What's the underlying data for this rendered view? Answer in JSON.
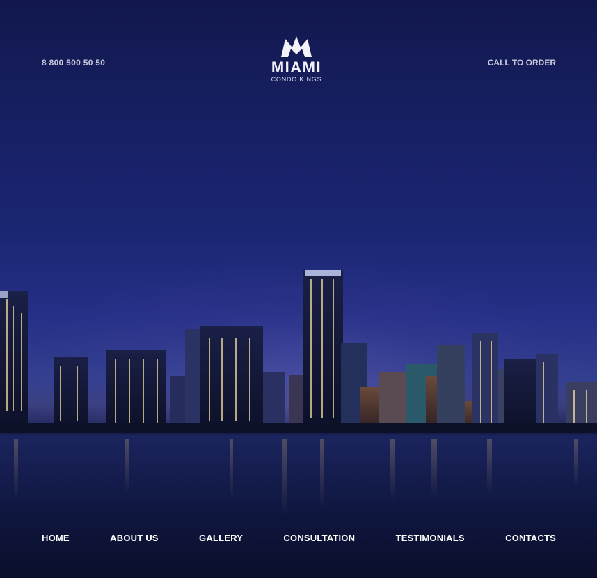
{
  "header": {
    "phone": "8 800 500 50 50",
    "cta_label": "CALL TO ORDER",
    "logo": {
      "title": "MIAMI",
      "subtitle": "CONDO KINGS",
      "icon": "crown-icon"
    }
  },
  "nav": {
    "items": [
      {
        "label": "HOME"
      },
      {
        "label": "ABOUT US"
      },
      {
        "label": "GALLERY"
      },
      {
        "label": "CONSULTATION"
      },
      {
        "label": "TESTIMONIALS"
      },
      {
        "label": "CONTACTS"
      }
    ]
  },
  "colors": {
    "sky_top": "#12184d",
    "sky_horizon": "#33408f",
    "water": "#0f1745",
    "text": "#ffffff",
    "muted_text": "#c6c8dc"
  }
}
